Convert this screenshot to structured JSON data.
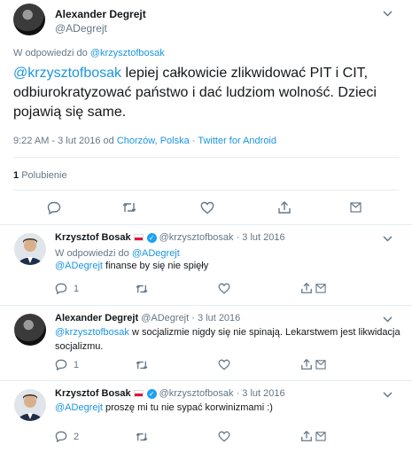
{
  "main_tweet": {
    "author_name": "Alexander Degrejt",
    "author_handle": "@ADegrejt",
    "reply_prefix": "W odpowiedzi do",
    "reply_to": "@krzysztofbosak",
    "mention": "@krzysztofbosak",
    "text_body": " lepiej całkowicie zlikwidować PIT i CIT, odbiurokratyzować państwo i dać ludziom wolność. Dzieci pojawią się same.",
    "time": "9:22 AM - 3 lut 2016 od",
    "location": "Chorzów, Polska",
    "separator": "·",
    "client": "Twitter for Android",
    "likes_count": "1",
    "likes_label": "Polubienie"
  },
  "replies": [
    {
      "author_name": "Krzysztof Bosak",
      "author_handle": "@krzysztofbosak",
      "date": "· 3 lut 2016",
      "reply_prefix": "W odpowiedzi do",
      "reply_to": "@ADegrejt",
      "mention": "@ADegrejt",
      "text_body": " finanse by się nie spięły",
      "reply_count": "1",
      "like_count": ""
    },
    {
      "author_name": "Alexander Degrejt",
      "author_handle": "@ADegrejt",
      "date": "· 3 lut 2016",
      "mention": "@krzysztofbosak",
      "text_body": " w socjalizmie nigdy się nie spinają. Lekarstwem jest likwidacja socjalizmu.",
      "reply_count": "1",
      "like_count": ""
    },
    {
      "author_name": "Krzysztof Bosak",
      "author_handle": "@krzysztofbosak",
      "date": "· 3 lut 2016",
      "mention": "@ADegrejt",
      "text_body": " proszę mi tu nie sypać korwinizmami :)",
      "reply_count": "2",
      "like_count": ""
    }
  ],
  "icons": {
    "reply": "reply-icon",
    "retweet": "retweet-icon",
    "like": "heart-icon",
    "share": "share-icon",
    "more": "chevron-down-icon",
    "verified": "verified-badge-icon",
    "flag": "poland-flag-icon"
  },
  "colors": {
    "link": "#1b95e0",
    "muted": "#657786",
    "verified": "#1da1f2",
    "divider": "#e6ecf0"
  }
}
